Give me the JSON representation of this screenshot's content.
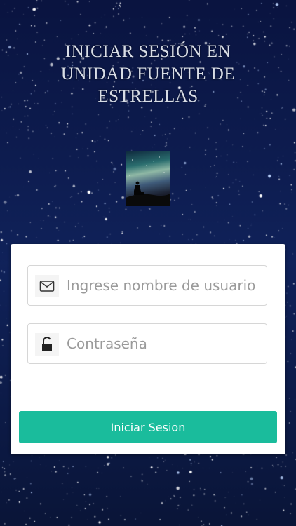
{
  "header": {
    "title_lines": [
      "INICIAR SESIÓN EN",
      "UNIDAD FUENTE DE",
      "ESTRELLAS"
    ]
  },
  "logo": {
    "icon": "silhouette-galaxy-image"
  },
  "form": {
    "username": {
      "placeholder": "Ingrese nombre de usuario",
      "value": "",
      "icon": "envelope-icon"
    },
    "password": {
      "placeholder": "Contraseña",
      "value": "",
      "icon": "unlock-icon"
    },
    "submit_label": "Iniciar Sesion"
  },
  "colors": {
    "background": "#0b1a45",
    "card": "#ffffff",
    "accent": "#1abc9c",
    "title_text": "#d8dde6"
  }
}
